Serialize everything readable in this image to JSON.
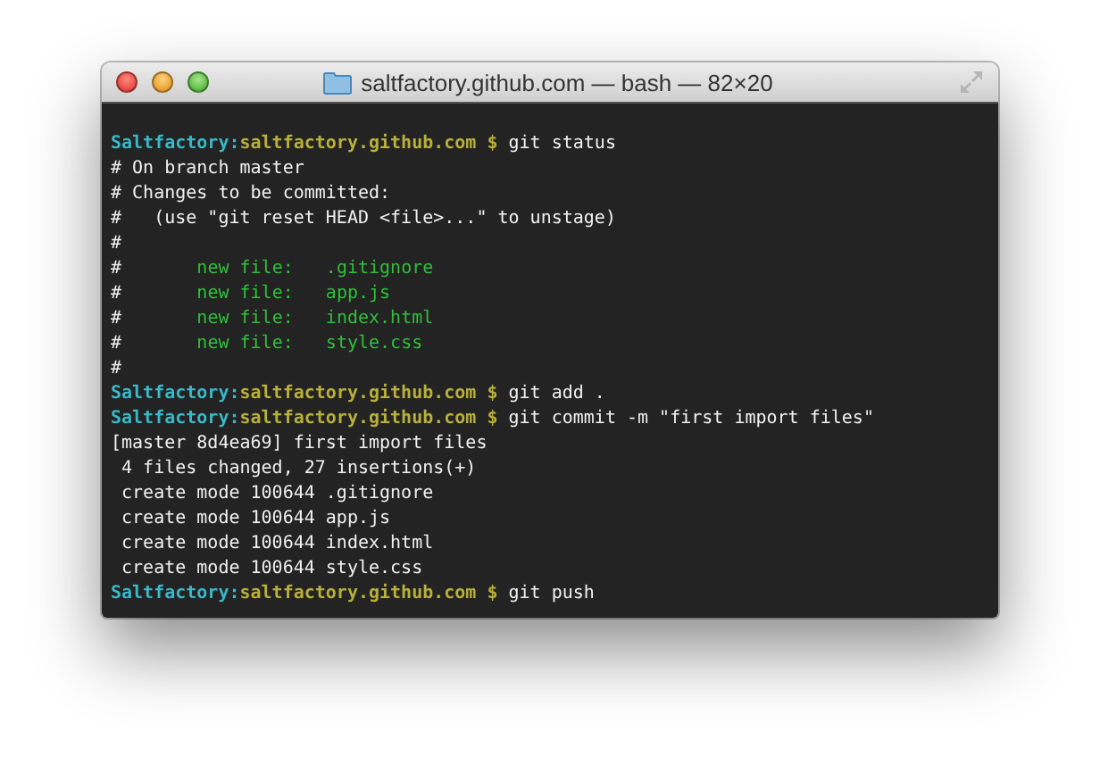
{
  "window": {
    "title": "saltfactory.github.com — bash — 82×20"
  },
  "terminal": {
    "lines": [
      [
        {
          "kind": "user",
          "text": "Saltfactory:"
        },
        {
          "kind": "host",
          "text": "saltfactory.github.com $"
        },
        {
          "kind": "plain",
          "text": " git status"
        }
      ],
      [
        {
          "kind": "plain",
          "text": "# On branch master"
        }
      ],
      [
        {
          "kind": "plain",
          "text": "# Changes to be committed:"
        }
      ],
      [
        {
          "kind": "plain",
          "text": "#   (use \"git reset HEAD <file>...\" to unstage)"
        }
      ],
      [
        {
          "kind": "plain",
          "text": "#"
        }
      ],
      [
        {
          "kind": "plain",
          "text": "#"
        },
        {
          "kind": "added",
          "text": "       new file:   .gitignore"
        }
      ],
      [
        {
          "kind": "plain",
          "text": "#"
        },
        {
          "kind": "added",
          "text": "       new file:   app.js"
        }
      ],
      [
        {
          "kind": "plain",
          "text": "#"
        },
        {
          "kind": "added",
          "text": "       new file:   index.html"
        }
      ],
      [
        {
          "kind": "plain",
          "text": "#"
        },
        {
          "kind": "added",
          "text": "       new file:   style.css"
        }
      ],
      [
        {
          "kind": "plain",
          "text": "#"
        }
      ],
      [
        {
          "kind": "user",
          "text": "Saltfactory:"
        },
        {
          "kind": "host",
          "text": "saltfactory.github.com $"
        },
        {
          "kind": "plain",
          "text": " git add ."
        }
      ],
      [
        {
          "kind": "user",
          "text": "Saltfactory:"
        },
        {
          "kind": "host",
          "text": "saltfactory.github.com $"
        },
        {
          "kind": "plain",
          "text": " git commit -m \"first import files\""
        }
      ],
      [
        {
          "kind": "plain",
          "text": "[master 8d4ea69] first import files"
        }
      ],
      [
        {
          "kind": "plain",
          "text": " 4 files changed, 27 insertions(+)"
        }
      ],
      [
        {
          "kind": "plain",
          "text": " create mode 100644 .gitignore"
        }
      ],
      [
        {
          "kind": "plain",
          "text": " create mode 100644 app.js"
        }
      ],
      [
        {
          "kind": "plain",
          "text": " create mode 100644 index.html"
        }
      ],
      [
        {
          "kind": "plain",
          "text": " create mode 100644 style.css"
        }
      ],
      [
        {
          "kind": "user",
          "text": "Saltfactory:"
        },
        {
          "kind": "host",
          "text": "saltfactory.github.com $"
        },
        {
          "kind": "plain",
          "text": " git push"
        }
      ]
    ]
  }
}
